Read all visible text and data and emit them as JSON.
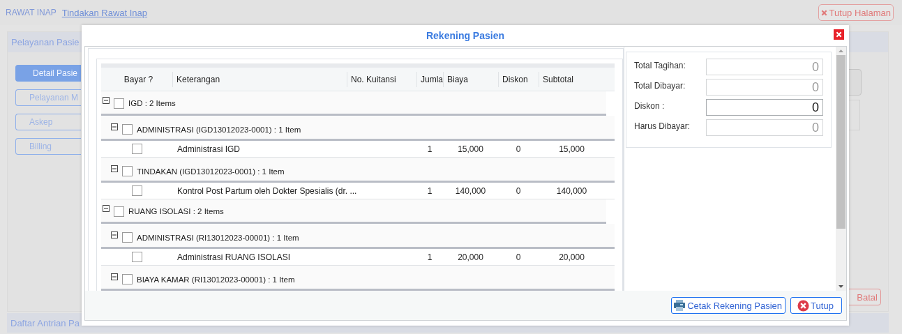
{
  "topbar": {
    "section": "RAWAT INAP",
    "link": "Tindakan Rawat Inap",
    "close_button": "Tutup Halaman"
  },
  "panel": {
    "title": "Pelayanan Pasie",
    "menu": [
      {
        "label": "Detail Pasie",
        "selected": true
      },
      {
        "label": "Pelayanan M",
        "selected": false
      },
      {
        "label": "Askep",
        "selected": false
      },
      {
        "label": "Billing",
        "selected": false
      }
    ],
    "cancel_button": "Batal"
  },
  "queue_panel": {
    "title": "Daftar Antrian Pa"
  },
  "dialog": {
    "title": "Rekening Pasien",
    "table": {
      "columns": [
        "Bayar ?",
        "Keterangan",
        "No. Kuitansi",
        "Jumla",
        "Biaya",
        "Diskon",
        "Subtotal"
      ],
      "groups": [
        {
          "label": "IGD : 2 Items",
          "expanded": true,
          "checked": false,
          "children": [
            {
              "label": "ADMINISTRASI (IGD13012023-0001) : 1 Item",
              "expanded": true,
              "checked": false,
              "rows": [
                {
                  "checked": false,
                  "description": "Administrasi IGD",
                  "qty": "1",
                  "price": "15,000",
                  "discount": "0",
                  "subtotal": "15,000"
                }
              ]
            },
            {
              "label": "TINDAKAN (IGD13012023-0001) : 1 Item",
              "expanded": true,
              "checked": false,
              "rows": [
                {
                  "checked": false,
                  "description": "Kontrol Post Partum oleh Dokter Spesialis (dr. ...",
                  "qty": "1",
                  "price": "140,000",
                  "discount": "0",
                  "subtotal": "140,000"
                }
              ]
            }
          ]
        },
        {
          "label": "RUANG ISOLASI : 2 Items",
          "expanded": true,
          "checked": false,
          "children": [
            {
              "label": "ADMINISTRASI (RI13012023-00001) : 1 Item",
              "expanded": true,
              "checked": false,
              "rows": [
                {
                  "checked": false,
                  "description": "Administrasi RUANG ISOLASI",
                  "qty": "1",
                  "price": "20,000",
                  "discount": "0",
                  "subtotal": "20,000"
                }
              ]
            },
            {
              "label": "BIAYA KAMAR (RI13012023-00001) : 1 Item",
              "expanded": true,
              "checked": false
            }
          ]
        }
      ]
    },
    "summary": [
      {
        "label": "Total Tagihan:",
        "value": "0",
        "disabled": true
      },
      {
        "label": "Total Dibayar:",
        "value": "0",
        "disabled": true
      },
      {
        "label": "Diskon :",
        "value": "0",
        "disabled": false
      },
      {
        "label": "Harus Dibayar:",
        "value": "0",
        "disabled": true
      }
    ],
    "buttons": [
      {
        "label": "Cetak Rekening Pasien",
        "kind": "print"
      },
      {
        "label": "Tutup",
        "kind": "close"
      }
    ]
  }
}
